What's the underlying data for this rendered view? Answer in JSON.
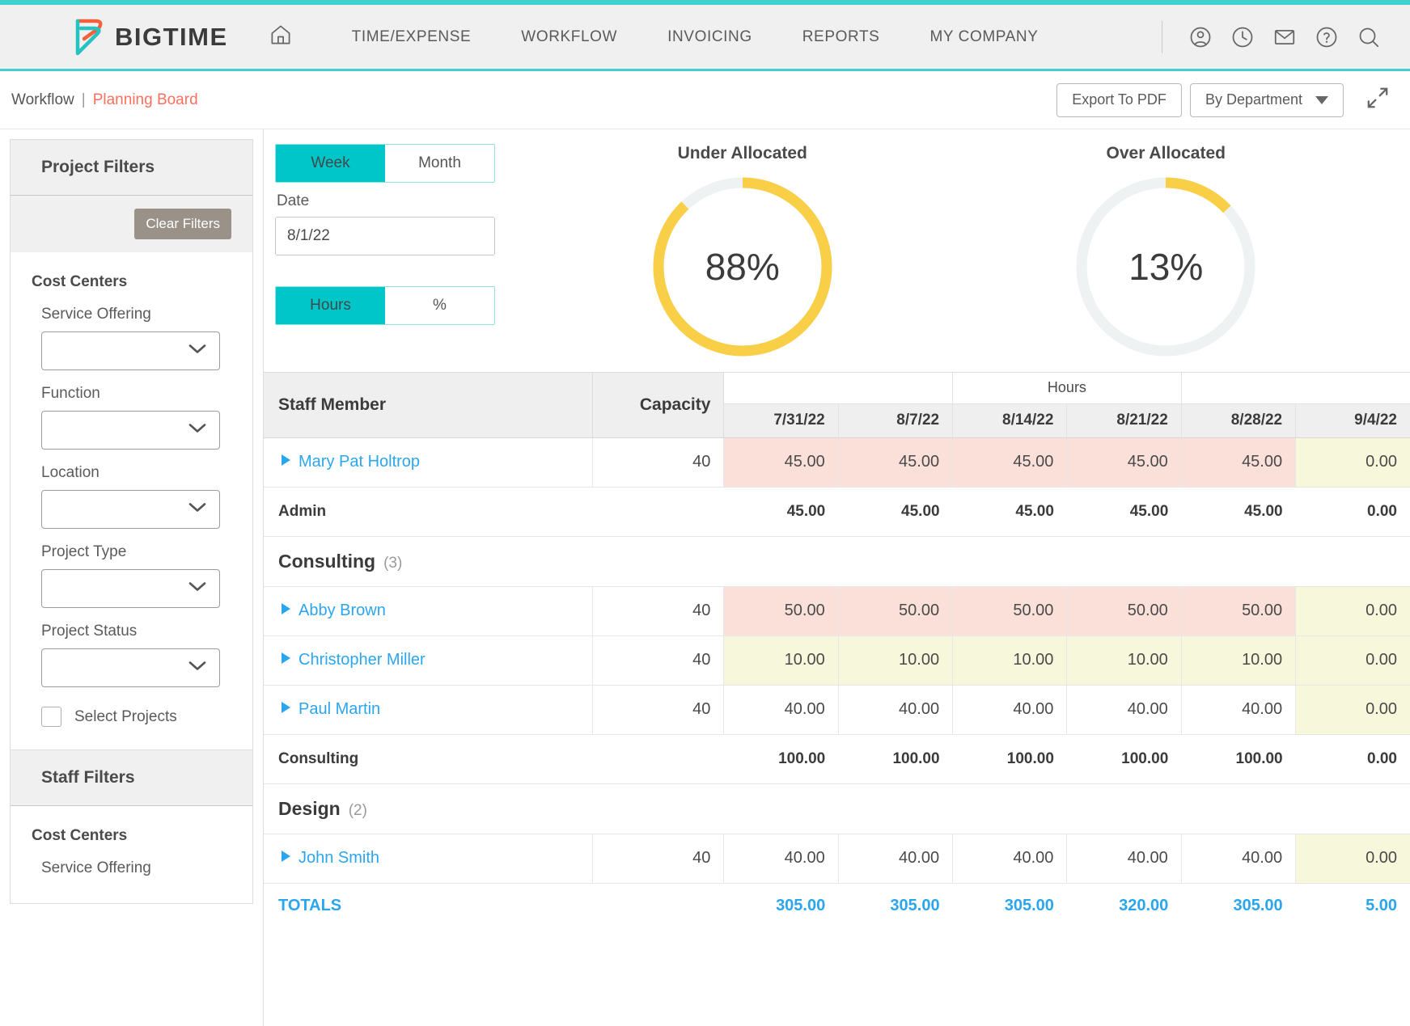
{
  "header": {
    "brand": "BIGTIME",
    "nav": [
      {
        "label": "TIME/EXPENSE"
      },
      {
        "label": "WORKFLOW"
      },
      {
        "label": "INVOICING"
      },
      {
        "label": "REPORTS"
      },
      {
        "label": "MY COMPANY"
      }
    ],
    "icons": [
      "home-icon",
      "user-icon",
      "clock-icon",
      "mail-icon",
      "help-icon",
      "search-icon"
    ],
    "accent_color": "#3fd0cf"
  },
  "breadcrumb": {
    "parent": "Workflow",
    "separator": "|",
    "current": "Planning Board",
    "current_color": "#ff6f5e"
  },
  "toolbar": {
    "export_label": "Export To PDF",
    "group_by_label": "By Department",
    "expand_icon": "expand-arrows-icon"
  },
  "sidebar": {
    "project_filters": {
      "title": "Project Filters",
      "clear_label": "Clear Filters",
      "group_title": "Cost Centers",
      "fields": [
        {
          "label": "Service Offering",
          "value": ""
        },
        {
          "label": "Function",
          "value": ""
        },
        {
          "label": "Location",
          "value": ""
        },
        {
          "label": "Project Type",
          "value": ""
        },
        {
          "label": "Project Status",
          "value": ""
        }
      ],
      "checkbox_label": "Select Projects",
      "checkbox_checked": false
    },
    "staff_filters": {
      "title": "Staff Filters",
      "group_title": "Cost Centers",
      "fields": [
        {
          "label": "Service Offering",
          "value": ""
        }
      ]
    }
  },
  "controls": {
    "period_toggle": {
      "options": [
        "Week",
        "Month"
      ],
      "selected": "Week"
    },
    "date_label": "Date",
    "date_value": "8/1/22",
    "date_placeholder": "",
    "unit_toggle": {
      "options": [
        "Hours",
        "%"
      ],
      "selected": "Hours"
    }
  },
  "chart_data": [
    {
      "type": "pie",
      "title": "Under Allocated",
      "categories": [
        "Under Allocated",
        "Remaining"
      ],
      "values": [
        88,
        12
      ],
      "value_label": "88%",
      "colors": [
        "#f8cf46",
        "#eef2f2"
      ],
      "subtype": "donut"
    },
    {
      "type": "pie",
      "title": "Over Allocated",
      "categories": [
        "Over Allocated",
        "Remaining"
      ],
      "values": [
        13,
        87
      ],
      "value_label": "13%",
      "colors": [
        "#f8cf46",
        "#eef2f2"
      ],
      "subtype": "donut"
    }
  ],
  "table": {
    "group_header": "Hours",
    "col_staff": "Staff Member",
    "col_capacity": "Capacity",
    "date_columns": [
      "7/31/22",
      "8/7/22",
      "8/14/22",
      "8/21/22",
      "8/28/22",
      "9/4/22"
    ],
    "rows": [
      {
        "kind": "staff",
        "name": "Mary Pat Holtrop",
        "capacity": "40",
        "values": [
          "45.00",
          "45.00",
          "45.00",
          "45.00",
          "45.00",
          "0.00"
        ],
        "states": [
          "over",
          "over",
          "over",
          "over",
          "over",
          "under"
        ]
      },
      {
        "kind": "subtotal",
        "name": "Admin",
        "values": [
          "45.00",
          "45.00",
          "45.00",
          "45.00",
          "45.00",
          "0.00"
        ]
      },
      {
        "kind": "group",
        "name": "Consulting",
        "count": "(3)"
      },
      {
        "kind": "staff",
        "name": "Abby Brown",
        "capacity": "40",
        "values": [
          "50.00",
          "50.00",
          "50.00",
          "50.00",
          "50.00",
          "0.00"
        ],
        "states": [
          "over",
          "over",
          "over",
          "over",
          "over",
          "under"
        ]
      },
      {
        "kind": "staff",
        "name": "Christopher Miller",
        "capacity": "40",
        "values": [
          "10.00",
          "10.00",
          "10.00",
          "10.00",
          "10.00",
          "0.00"
        ],
        "states": [
          "under",
          "under",
          "under",
          "under",
          "under",
          "under"
        ]
      },
      {
        "kind": "staff",
        "name": "Paul Martin",
        "capacity": "40",
        "values": [
          "40.00",
          "40.00",
          "40.00",
          "40.00",
          "40.00",
          "0.00"
        ],
        "states": [
          "none",
          "none",
          "none",
          "none",
          "none",
          "under"
        ]
      },
      {
        "kind": "subtotal",
        "name": "Consulting",
        "values": [
          "100.00",
          "100.00",
          "100.00",
          "100.00",
          "100.00",
          "0.00"
        ]
      },
      {
        "kind": "group",
        "name": "Design",
        "count": "(2)"
      },
      {
        "kind": "staff",
        "name": "John Smith",
        "capacity": "40",
        "values": [
          "40.00",
          "40.00",
          "40.00",
          "40.00",
          "40.00",
          "0.00"
        ],
        "states": [
          "none",
          "none",
          "none",
          "none",
          "none",
          "under"
        ]
      }
    ],
    "totals": {
      "label": "TOTALS",
      "values": [
        "305.00",
        "305.00",
        "305.00",
        "320.00",
        "305.00",
        "5.00"
      ]
    }
  }
}
